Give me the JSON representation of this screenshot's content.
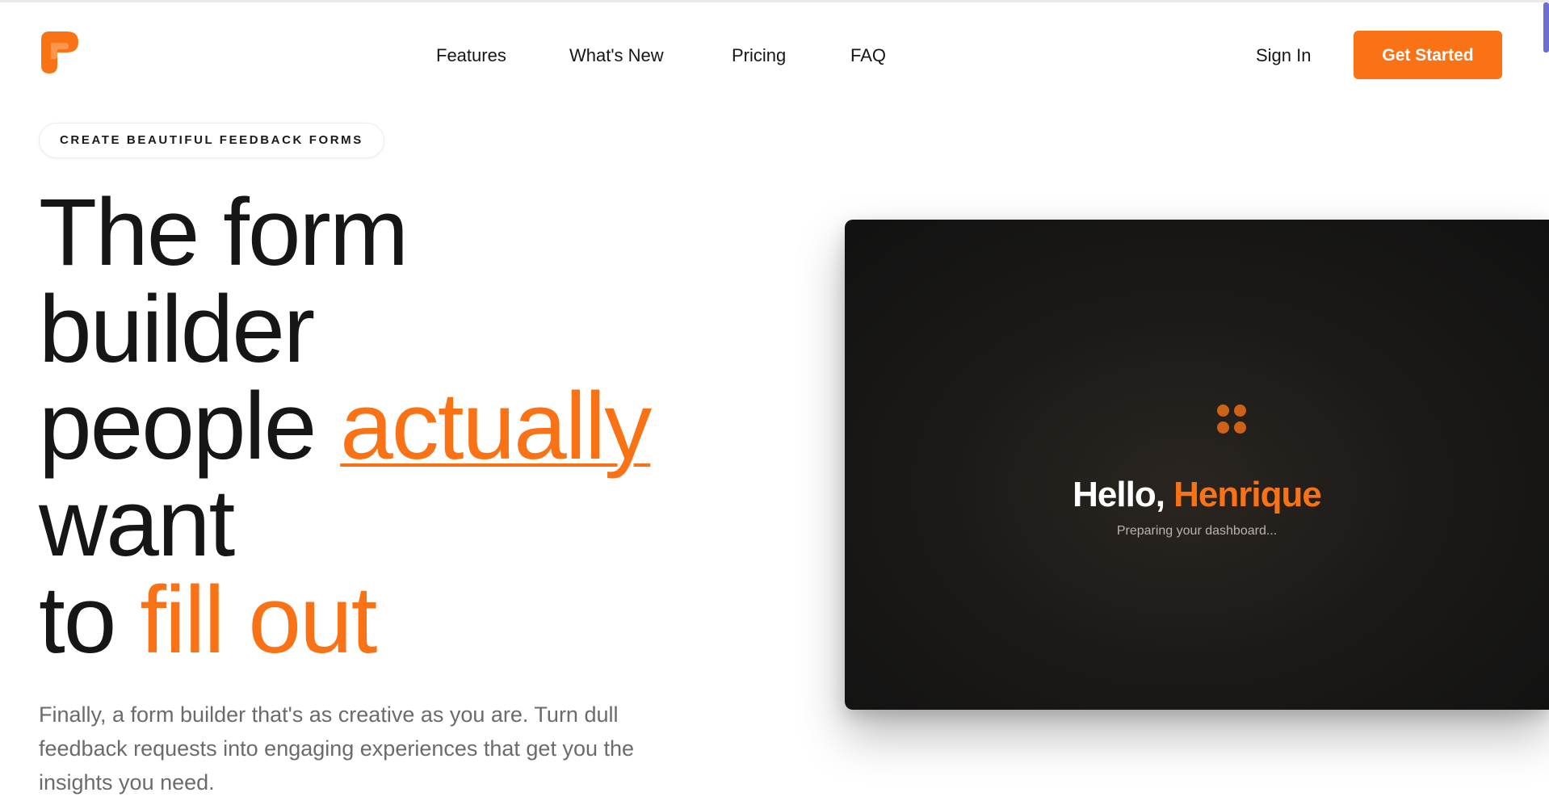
{
  "header": {
    "logo_icon": "brand-logo-icon",
    "nav": [
      {
        "label": "Features"
      },
      {
        "label": "What's New"
      },
      {
        "label": "Pricing"
      },
      {
        "label": "FAQ"
      }
    ],
    "sign_in_label": "Sign In",
    "get_started_label": "Get Started"
  },
  "hero": {
    "eyebrow": "CREATE BEAUTIFUL FEEDBACK FORMS",
    "headline": {
      "line1": "The form",
      "line2": "builder",
      "line3_plain": "people ",
      "line3_accent": "actually",
      "line4": "want",
      "line5_plain": "to ",
      "line5_accent": "fill out"
    },
    "subtext": "Finally, a form builder that's as creative as you are. Turn dull feedback requests into engaging experiences that get you the insights you need."
  },
  "preview": {
    "loader_icon": "four-dots-loader-icon",
    "greeting_prefix": "Hello, ",
    "greeting_name": "Henrique",
    "loading_text": "Preparing your dashboard..."
  },
  "colors": {
    "accent": "#f97316",
    "text": "#161616",
    "muted": "#6b6b6b",
    "card_bg": "#171717"
  }
}
